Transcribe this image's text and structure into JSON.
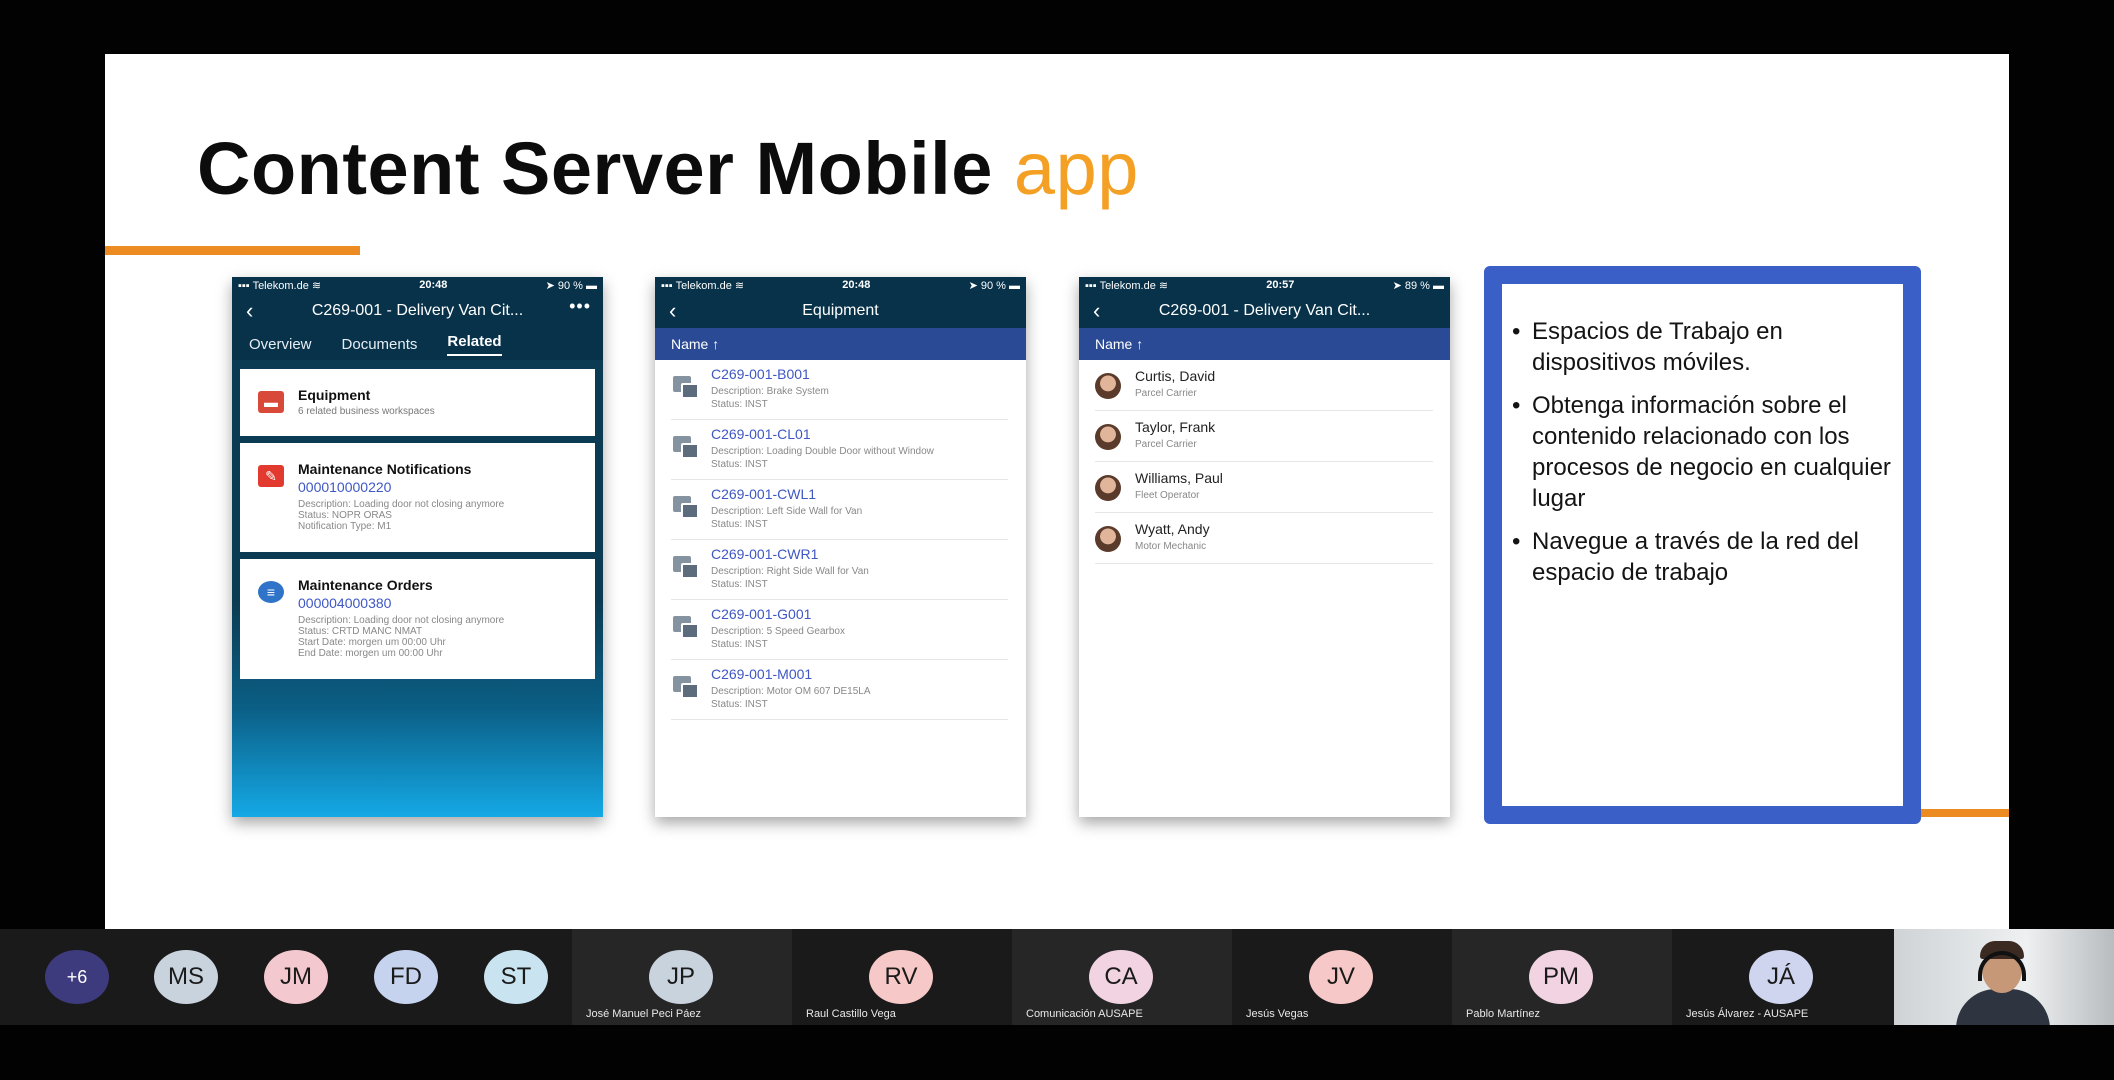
{
  "slide": {
    "title_main": "Content Server Mobile",
    "title_accent": "app"
  },
  "phone1": {
    "status": {
      "carrier": "Telekom.de",
      "time": "20:48",
      "battery": "90 %"
    },
    "title": "C269-001 - Delivery Van Cit...",
    "more_label": "•••",
    "tabs": [
      "Overview",
      "Documents",
      "Related"
    ],
    "active_tab": "Related",
    "cards": [
      {
        "title": "Equipment",
        "subtitle": "6 related business workspaces"
      },
      {
        "title": "Maintenance Notifications",
        "number": "000010000220",
        "lines": [
          "Description: Loading door not closing anymore",
          "Status: NOPR ORAS",
          "Notification Type: M1"
        ]
      },
      {
        "title": "Maintenance Orders",
        "number": "000004000380",
        "lines": [
          "Description: Loading door not closing anymore",
          "Status: CRTD MANC NMAT",
          "Start Date: morgen um 00:00 Uhr",
          "End Date: morgen um 00:00 Uhr"
        ]
      }
    ]
  },
  "phone2": {
    "status": {
      "carrier": "Telekom.de",
      "time": "20:48",
      "battery": "90 %"
    },
    "title": "Equipment",
    "sort_label": "Name ↑",
    "items": [
      {
        "id": "C269-001-B001",
        "desc": "Description: Brake System",
        "status": "Status: INST"
      },
      {
        "id": "C269-001-CL01",
        "desc": "Description: Loading Double Door without Window",
        "status": "Status: INST"
      },
      {
        "id": "C269-001-CWL1",
        "desc": "Description: Left Side Wall for Van",
        "status": "Status: INST"
      },
      {
        "id": "C269-001-CWR1",
        "desc": "Description: Right Side Wall for Van",
        "status": "Status: INST"
      },
      {
        "id": "C269-001-G001",
        "desc": "Description: 5 Speed Gearbox",
        "status": "Status: INST"
      },
      {
        "id": "C269-001-M001",
        "desc": "Description: Motor OM 607 DE15LA",
        "status": "Status: INST"
      }
    ]
  },
  "phone3": {
    "status": {
      "carrier": "Telekom.de",
      "time": "20:57",
      "battery": "89 %"
    },
    "title": "C269-001 - Delivery Van Cit...",
    "sort_label": "Name ↑",
    "people": [
      {
        "name": "Curtis, David",
        "role": "Parcel Carrier"
      },
      {
        "name": "Taylor, Frank",
        "role": "Parcel Carrier"
      },
      {
        "name": "Williams, Paul",
        "role": "Fleet Operator"
      },
      {
        "name": "Wyatt, Andy",
        "role": "Motor Mechanic"
      }
    ]
  },
  "bullets": [
    "Espacios de Trabajo en dispositivos móviles.",
    "Obtenga información sobre el contenido relacionado con los procesos de negocio en cualquier lugar",
    "Navegue a través de la red del espacio de trabajo"
  ],
  "participants": {
    "overflow": "+6",
    "initials_only": [
      {
        "initials": "MS",
        "color": "#c9d3de"
      },
      {
        "initials": "JM",
        "color": "#f3c9cf"
      },
      {
        "initials": "FD",
        "color": "#c6d3ee"
      },
      {
        "initials": "ST",
        "color": "#c9e4f0"
      }
    ],
    "named": [
      {
        "initials": "JP",
        "name": "José Manuel Peci Páez",
        "color": "#c9d3de"
      },
      {
        "initials": "RV",
        "name": "Raul Castillo Vega",
        "color": "#f6c8c8"
      },
      {
        "initials": "CA",
        "name": "Comunicación AUSAPE",
        "color": "#f1d3e2"
      },
      {
        "initials": "JV",
        "name": "Jesús Vegas",
        "color": "#f6c8c8"
      },
      {
        "initials": "PM",
        "name": "Pablo Martínez",
        "color": "#f1d3e2"
      },
      {
        "initials": "JÁ",
        "name": "Jesús Álvarez - AUSAPE",
        "color": "#cfd5ee"
      }
    ]
  },
  "colors": {
    "accent_orange": "#f4a024",
    "rule_orange": "#ec8b21",
    "box_blue": "#3a5fc7",
    "nav_dark": "#07324a",
    "sort_bar": "#2a4a95",
    "link_blue": "#3f57c4"
  }
}
